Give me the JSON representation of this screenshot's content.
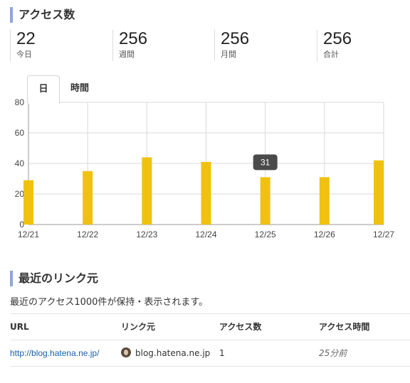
{
  "access": {
    "title": "アクセス数",
    "stats": [
      {
        "value": "22",
        "label": "今日"
      },
      {
        "value": "256",
        "label": "週間"
      },
      {
        "value": "256",
        "label": "月間"
      },
      {
        "value": "256",
        "label": "合計"
      }
    ],
    "tabs": [
      {
        "label": "日",
        "active": true
      },
      {
        "label": "時間",
        "active": false
      }
    ],
    "tooltip": "31"
  },
  "chart_data": {
    "type": "bar",
    "categories": [
      "12/21",
      "12/22",
      "12/23",
      "12/24",
      "12/25",
      "12/26",
      "12/27"
    ],
    "values": [
      29,
      35,
      44,
      41,
      31,
      31,
      42
    ],
    "ylim": [
      0,
      80
    ],
    "yticks": [
      0,
      20,
      40,
      60,
      80
    ],
    "grid": true,
    "bar_color": "#f0c20f",
    "highlighted_category": "12/25"
  },
  "recent": {
    "title": "最近のリンク元",
    "description": "最近のアクセス1000件が保持・表示されます。",
    "columns": [
      "URL",
      "リンク元",
      "アクセス数",
      "アクセス時間"
    ],
    "rows": [
      {
        "url": "http://blog.hatena.ne.jp/",
        "referrer": "blog.hatena.ne.jp",
        "count": "1",
        "time": "25分前"
      }
    ]
  }
}
